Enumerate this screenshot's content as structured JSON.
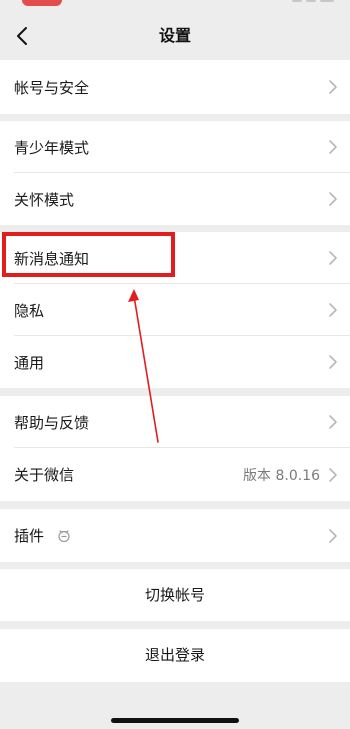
{
  "nav": {
    "title": "设置",
    "back_icon": "chevron-left-icon"
  },
  "groups": {
    "account": {
      "label": "帐号与安全"
    },
    "modes": {
      "teen_mode": "青少年模式",
      "care_mode": "关怀模式"
    },
    "notifications": {
      "new_message": "新消息通知",
      "privacy": "隐私",
      "general": "通用"
    },
    "about": {
      "help": "帮助与反馈",
      "about_wechat": "关于微信",
      "version": "版本 8.0.16"
    },
    "plugins": {
      "label": "插件",
      "icon": "plugin-shield-icon"
    }
  },
  "actions": {
    "switch_account": "切换帐号",
    "logout": "退出登录"
  },
  "annotation": {
    "highlight_color": "#e11e1e",
    "target": "新消息通知"
  }
}
